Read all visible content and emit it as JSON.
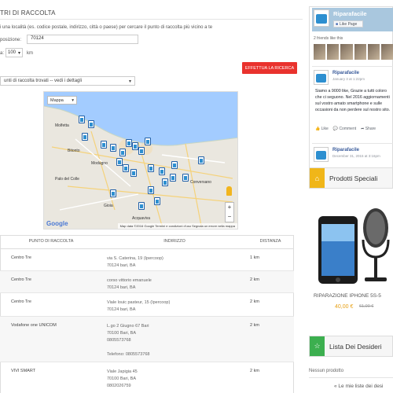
{
  "form": {
    "section_title": "TRI DI RACCOLTA",
    "instructions": "i una località (es. codice postale, indirizzo, città o paese) per cercare il punto di raccolta più vicino a te",
    "position_label": "posizione:",
    "position_value": "70124",
    "distance_label": "a:",
    "distance_value": "100",
    "distance_unit": "km",
    "search_button": "EFFETTUA LA RICERCA",
    "results_select": "unti di raccolta trovati -- vedi i dettagli"
  },
  "map": {
    "type_control": "Mappa",
    "google_logo": "Google",
    "footer": "Map data ©2016 Google   Termini e condizioni d'uso   Segnala un errore nella mappa",
    "places": [
      "Molfetta",
      "Bitonto",
      "Modugno",
      "Palo del Colle",
      "Conversano",
      "Acquaviva",
      "Gioia"
    ]
  },
  "table": {
    "headers": [
      "PUNTO DI RACCOLTA",
      "INDIRIZZO",
      "DISTANZA"
    ],
    "rows": [
      {
        "name": "Centro Tre",
        "addr1": "via S. Caterina, 19 (Ipercoop)",
        "addr2": "70124 bari, BA",
        "addr3": "",
        "addr4": "",
        "distance": "1 km"
      },
      {
        "name": "Centro Tre",
        "addr1": "corso vittorio emanuele",
        "addr2": "70124 bari, BA",
        "addr3": "",
        "addr4": "",
        "distance": "2 km"
      },
      {
        "name": "Centro Tre",
        "addr1": "Viale louic pasteur, 15 (Ipercoop)",
        "addr2": "70124 bari, BA",
        "addr3": "",
        "addr4": "",
        "distance": "2 km"
      },
      {
        "name": "Vodafone one UNICOM",
        "addr1": "L.go 2 Giugno 67 Bari",
        "addr2": "70100 Bari, BA",
        "addr3": "0805573768",
        "addr4": "Telefono: 0805573768",
        "distance": "2 km"
      },
      {
        "name": "VIVI SMART",
        "addr1": "Viale Japigia 45",
        "addr2": "70100 Bari, BA",
        "addr3": "0802026759",
        "addr4": "",
        "distance": "2 km"
      }
    ]
  },
  "facebook": {
    "page_name": "Riparafacile",
    "like_button": "Like Page",
    "friends_text": "2 friends like this",
    "posts": [
      {
        "name": "Riparafacile",
        "date": "January 3 at 1:22pm",
        "text": "Siamo a 9000 like, Grazie a tutti coloro che ci seguono. Nel 2016 aggiornamenti sul vostro amato smartphone e sulle occasioni da non perdere sul nostro sito.",
        "like": "Like",
        "comment": "Comment",
        "share": "Share"
      },
      {
        "name": "Riparafacile",
        "date": "December 31, 2015 at 3:16pm"
      }
    ]
  },
  "specials": {
    "title": "Prodotti Speciali",
    "product_name": "RIPARAZIONE IPHONE 5S-5",
    "price": "40,00 €",
    "old_price": "61,00 €"
  },
  "wishlist": {
    "title": "Lista Dei Desideri",
    "empty": "Nessun prodotto",
    "link": "« Le mie liste dei desi"
  },
  "colors": {
    "accent_red": "#e9322d",
    "special_yellow": "#f0b619",
    "wishlist_green": "#3caf4f",
    "price_orange": "#e7a118",
    "facebook_blue": "#365899"
  }
}
